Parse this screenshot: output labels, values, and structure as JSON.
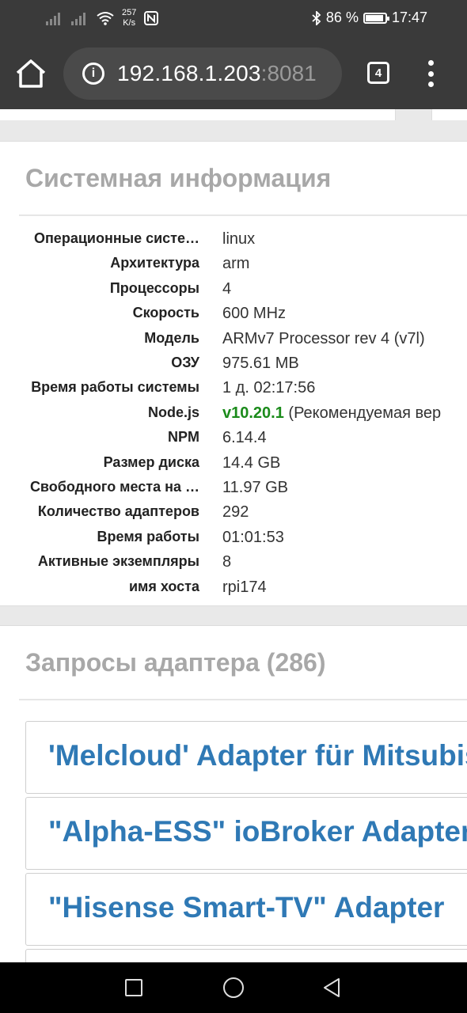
{
  "status_bar": {
    "net_speed_value": "257",
    "net_speed_unit": "K/s",
    "battery_percent": "86 %",
    "battery_level": 0.86,
    "time": "17:47"
  },
  "browser": {
    "url_host": "192.168.1.203",
    "url_port": ":8081",
    "tab_count": "4"
  },
  "system_info": {
    "title": "Системная информация",
    "rows": [
      {
        "label": "Операционные систе…",
        "value": "linux"
      },
      {
        "label": "Архитектура",
        "value": "arm"
      },
      {
        "label": "Процессоры",
        "value": "4"
      },
      {
        "label": "Скорость",
        "value": "600 MHz"
      },
      {
        "label": "Модель",
        "value": "ARMv7 Processor rev 4 (v7l)"
      },
      {
        "label": "ОЗУ",
        "value": "975.61 MB"
      },
      {
        "label": "Время работы системы",
        "value": "1 д. 02:17:56"
      },
      {
        "label": "Node.js",
        "value_highlight": "v10.20.1",
        "value_suffix": " (Рекомендуемая вер"
      },
      {
        "label": "NPM",
        "value": "6.14.4"
      },
      {
        "label": "Размер диска",
        "value": "14.4 GB"
      },
      {
        "label": "Свободного места на …",
        "value": "11.97 GB"
      },
      {
        "label": "Количество адаптеров",
        "value": "292"
      },
      {
        "label": "Время работы",
        "value": "01:01:53"
      },
      {
        "label": "Активные экземпляры",
        "value": "8"
      },
      {
        "label": "имя хоста",
        "value": "rpi174"
      }
    ]
  },
  "adapter_requests": {
    "title": "Запросы адаптера (286)",
    "items": [
      "'Melcloud' Adapter für Mitsubishi",
      "\"Alpha-ESS\" ioBroker Adapter",
      "\"Hisense Smart-TV\" Adapter"
    ]
  }
}
